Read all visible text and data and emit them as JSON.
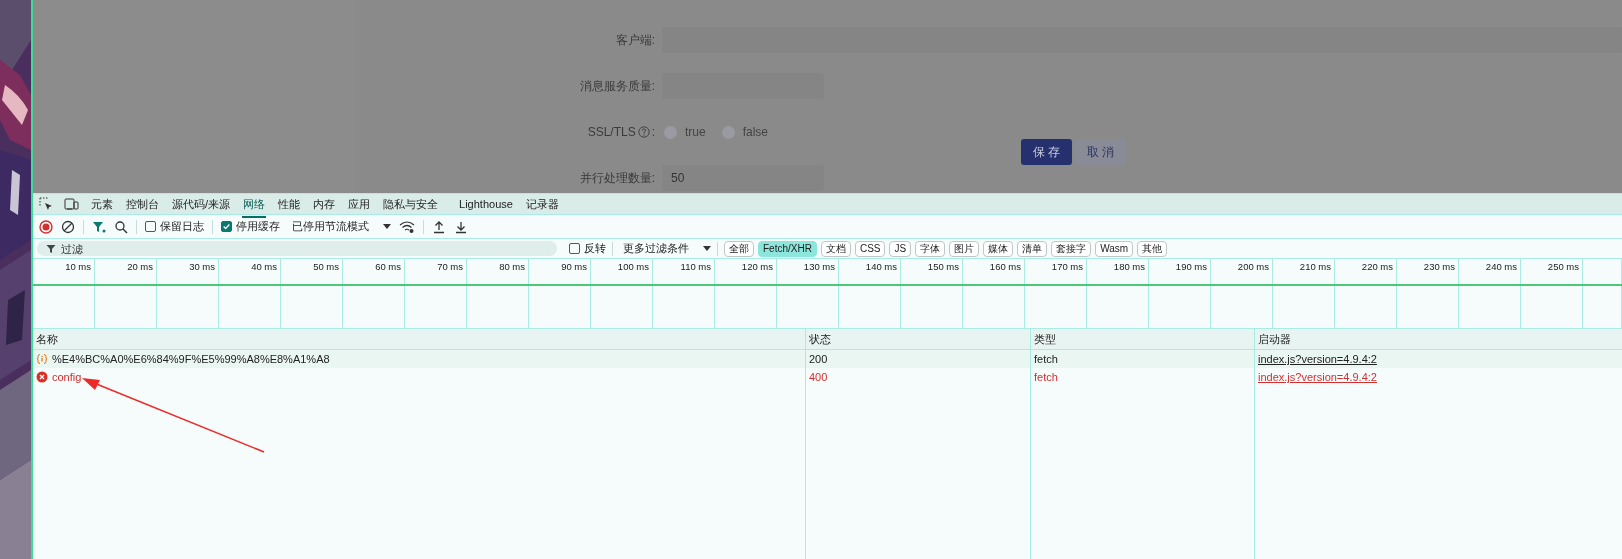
{
  "page": {
    "form": {
      "fields": [
        {
          "kind": "text",
          "label": "客户端:",
          "wide": true
        },
        {
          "kind": "text",
          "label": "消息服务质量:",
          "wide": false
        },
        {
          "kind": "radio",
          "label": "SSL/TLS",
          "after_icon": ":",
          "options": [
            {
              "label": "true",
              "selected": false
            },
            {
              "label": "false",
              "selected": false
            }
          ]
        },
        {
          "kind": "text",
          "label": "并行处理数量:",
          "value": "50",
          "wide": false
        }
      ],
      "buttons": [
        {
          "label": "保 存",
          "kind": "primary"
        },
        {
          "label": "取 消",
          "kind": "secondary"
        }
      ]
    }
  },
  "devtools": {
    "tabs": [
      {
        "label": "元素",
        "selected": false
      },
      {
        "label": "控制台",
        "selected": false
      },
      {
        "label": "源代码/来源",
        "selected": false
      },
      {
        "label": "网络",
        "selected": true
      },
      {
        "label": "性能",
        "selected": false
      },
      {
        "label": "内存",
        "selected": false
      },
      {
        "label": "应用",
        "selected": false
      },
      {
        "label": "隐私与安全",
        "selected": false
      },
      {
        "label": "Lighthouse",
        "selected": false
      },
      {
        "label": "记录器",
        "selected": false
      }
    ],
    "toolbar": {
      "recording": true,
      "filter_on": true,
      "preserve_log": {
        "label": "保留日志",
        "checked": false
      },
      "disable_cache": {
        "label": "停用缓存",
        "checked": true
      },
      "throttling": "已停用节流模式"
    },
    "filter": {
      "placeholder": "过滤",
      "invert": {
        "label": "反转",
        "checked": false
      },
      "more": "更多过滤条件",
      "types": [
        {
          "label": "全部",
          "selected": false
        },
        {
          "label": "Fetch/XHR",
          "selected": true
        },
        {
          "label": "文档",
          "selected": false
        },
        {
          "label": "CSS",
          "selected": false
        },
        {
          "label": "JS",
          "selected": false
        },
        {
          "label": "字体",
          "selected": false
        },
        {
          "label": "图片",
          "selected": false
        },
        {
          "label": "媒体",
          "selected": false
        },
        {
          "label": "清单",
          "selected": false
        },
        {
          "label": "套接字",
          "selected": false
        },
        {
          "label": "Wasm",
          "selected": false
        },
        {
          "label": "其他",
          "selected": false
        }
      ]
    },
    "timeline": {
      "ticks": [
        "10 ms",
        "20 ms",
        "30 ms",
        "40 ms",
        "50 ms",
        "60 ms",
        "70 ms",
        "80 ms",
        "90 ms",
        "100 ms",
        "110 ms",
        "120 ms",
        "130 ms",
        "140 ms",
        "150 ms",
        "160 ms",
        "170 ms",
        "180 ms",
        "190 ms",
        "200 ms",
        "210 ms",
        "220 ms",
        "230 ms",
        "240 ms",
        "250 ms"
      ]
    },
    "table": {
      "columns": [
        "名称",
        "状态",
        "类型",
        "启动器"
      ],
      "rows": [
        {
          "kind": "ok",
          "name": "%E4%BC%A0%E6%84%9F%E5%99%A8%E8%A1%A8",
          "status": "200",
          "type": "fetch",
          "initiator": "index.js?version=4.9.4:2"
        },
        {
          "kind": "error",
          "name": "config",
          "status": "400",
          "type": "fetch",
          "initiator": "index.js?version=4.9.4:2"
        }
      ]
    }
  }
}
